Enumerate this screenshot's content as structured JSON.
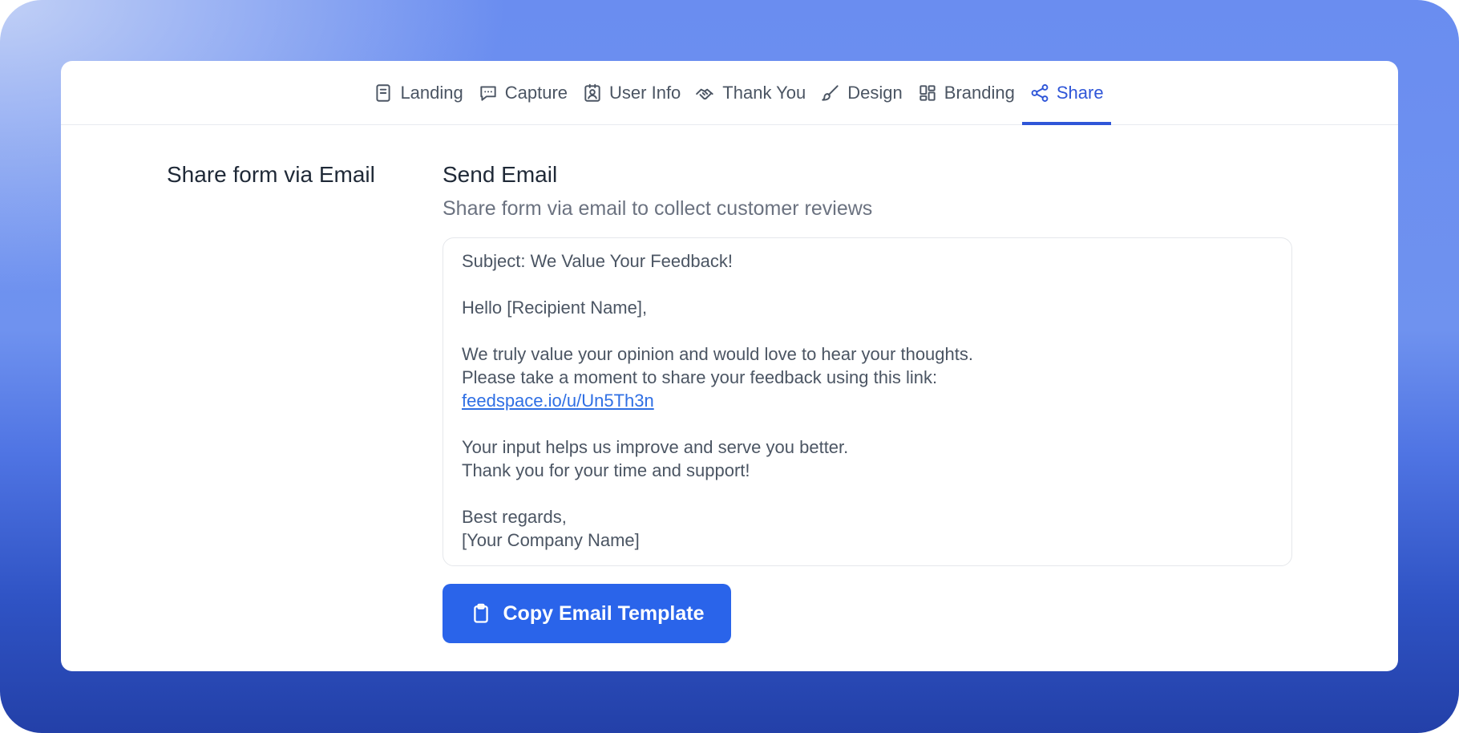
{
  "tabs": [
    {
      "label": "Landing",
      "icon": "document-icon",
      "active": false
    },
    {
      "label": "Capture",
      "icon": "chat-icon",
      "active": false
    },
    {
      "label": "User Info",
      "icon": "user-badge-icon",
      "active": false
    },
    {
      "label": "Thank You",
      "icon": "handshake-icon",
      "active": false
    },
    {
      "label": "Design",
      "icon": "brush-icon",
      "active": false
    },
    {
      "label": "Branding",
      "icon": "layout-grid-icon",
      "active": false
    },
    {
      "label": "Share",
      "icon": "share-icon",
      "active": true
    }
  ],
  "section": {
    "left_title": "Share form via Email",
    "title": "Send Email",
    "subtitle": "Share form via email to collect customer reviews"
  },
  "email": {
    "subject": "Subject: We Value Your Feedback!",
    "greeting": "Hello [Recipient Name],",
    "body_line1": "We truly value your opinion and would love to hear your thoughts.",
    "body_line2": "Please take a moment to share your feedback using this link:",
    "link": "feedspace.io/u/Un5Th3n",
    "closing_line1": "Your input helps us improve and serve you better.",
    "closing_line2": "Thank you for your time and support!",
    "signoff": "Best regards,",
    "signature": "[Your Company Name]"
  },
  "copy_button": {
    "label": "Copy Email Template",
    "icon": "clipboard-icon"
  },
  "colors": {
    "accent": "#2f56d8",
    "button": "#2a64ea",
    "link": "#2f6fe4"
  }
}
